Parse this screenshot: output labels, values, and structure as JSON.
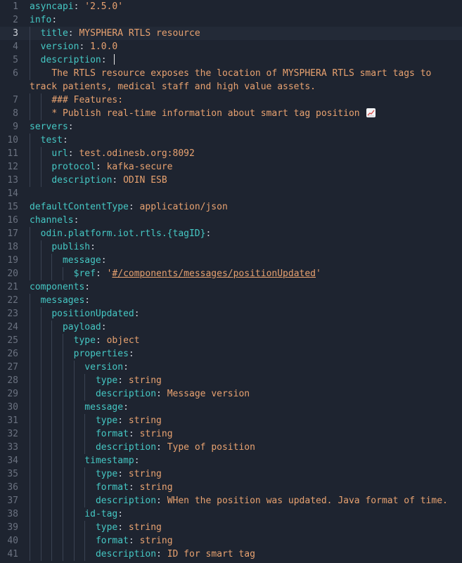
{
  "editor": {
    "current_line": 3,
    "lines": [
      {
        "n": "1",
        "indent": 0,
        "parts": [
          [
            "k",
            "asyncapi"
          ],
          [
            "p",
            ": "
          ],
          [
            "v",
            "'2.5.0'"
          ]
        ]
      },
      {
        "n": "2",
        "indent": 0,
        "parts": [
          [
            "k",
            "info"
          ],
          [
            "p",
            ":"
          ]
        ]
      },
      {
        "n": "3",
        "indent": 1,
        "parts": [
          [
            "k",
            "title"
          ],
          [
            "p",
            ": "
          ],
          [
            "v",
            "MYSPHERA RTLS resource"
          ]
        ]
      },
      {
        "n": "4",
        "indent": 1,
        "parts": [
          [
            "k",
            "version"
          ],
          [
            "p",
            ": "
          ],
          [
            "v",
            "1.0.0"
          ]
        ]
      },
      {
        "n": "5",
        "indent": 1,
        "parts": [
          [
            "k",
            "description"
          ],
          [
            "p",
            ": "
          ],
          [
            "v",
            "|"
          ]
        ]
      },
      {
        "n": "6",
        "indent": 1,
        "parts": [
          [
            "v",
            "  The RTLS resource exposes the location of MYSPHERA RTLS smart tags to track patients, medical staff and high value assets."
          ]
        ],
        "wrap": true
      },
      {
        "n": "7",
        "indent": 2,
        "parts": [
          [
            "v",
            "### Features:"
          ]
        ]
      },
      {
        "n": "8",
        "indent": 2,
        "parts": [
          [
            "v",
            "* Publish real-time information about smart tag position "
          ]
        ],
        "emoji": "chart-increasing-icon"
      },
      {
        "n": "9",
        "indent": 0,
        "parts": [
          [
            "k",
            "servers"
          ],
          [
            "p",
            ":"
          ]
        ]
      },
      {
        "n": "10",
        "indent": 1,
        "parts": [
          [
            "k",
            "test"
          ],
          [
            "p",
            ":"
          ]
        ]
      },
      {
        "n": "11",
        "indent": 2,
        "parts": [
          [
            "k",
            "url"
          ],
          [
            "p",
            ": "
          ],
          [
            "v",
            "test.odinesb.org:8092"
          ]
        ]
      },
      {
        "n": "12",
        "indent": 2,
        "parts": [
          [
            "k",
            "protocol"
          ],
          [
            "p",
            ": "
          ],
          [
            "v",
            "kafka-secure"
          ]
        ]
      },
      {
        "n": "13",
        "indent": 2,
        "parts": [
          [
            "k",
            "description"
          ],
          [
            "p",
            ": "
          ],
          [
            "v",
            "ODIN ESB"
          ]
        ]
      },
      {
        "n": "14",
        "indent": 0,
        "parts": []
      },
      {
        "n": "15",
        "indent": 0,
        "parts": [
          [
            "k",
            "defaultContentType"
          ],
          [
            "p",
            ": "
          ],
          [
            "v",
            "application/json"
          ]
        ]
      },
      {
        "n": "16",
        "indent": 0,
        "parts": [
          [
            "k",
            "channels"
          ],
          [
            "p",
            ":"
          ]
        ]
      },
      {
        "n": "17",
        "indent": 1,
        "parts": [
          [
            "k",
            "odin.platform.iot.rtls.{tagID}"
          ],
          [
            "p",
            ":"
          ]
        ]
      },
      {
        "n": "18",
        "indent": 2,
        "parts": [
          [
            "k",
            "publish"
          ],
          [
            "p",
            ":"
          ]
        ]
      },
      {
        "n": "19",
        "indent": 3,
        "parts": [
          [
            "k",
            "message"
          ],
          [
            "p",
            ":"
          ]
        ]
      },
      {
        "n": "20",
        "indent": 4,
        "parts": [
          [
            "k",
            "$ref"
          ],
          [
            "p",
            ": "
          ],
          [
            "v",
            "'"
          ],
          [
            "u",
            "#/components/messages/positionUpdated"
          ],
          [
            "v",
            "'"
          ]
        ]
      },
      {
        "n": "21",
        "indent": 0,
        "parts": [
          [
            "k",
            "components"
          ],
          [
            "p",
            ":"
          ]
        ]
      },
      {
        "n": "22",
        "indent": 1,
        "parts": [
          [
            "k",
            "messages"
          ],
          [
            "p",
            ":"
          ]
        ]
      },
      {
        "n": "23",
        "indent": 2,
        "parts": [
          [
            "k",
            "positionUpdated"
          ],
          [
            "p",
            ":"
          ]
        ]
      },
      {
        "n": "24",
        "indent": 3,
        "parts": [
          [
            "k",
            "payload"
          ],
          [
            "p",
            ":"
          ]
        ]
      },
      {
        "n": "25",
        "indent": 4,
        "parts": [
          [
            "k",
            "type"
          ],
          [
            "p",
            ": "
          ],
          [
            "v",
            "object"
          ]
        ]
      },
      {
        "n": "26",
        "indent": 4,
        "parts": [
          [
            "k",
            "properties"
          ],
          [
            "p",
            ":"
          ]
        ]
      },
      {
        "n": "27",
        "indent": 5,
        "parts": [
          [
            "k",
            "version"
          ],
          [
            "p",
            ":"
          ]
        ]
      },
      {
        "n": "28",
        "indent": 6,
        "parts": [
          [
            "k",
            "type"
          ],
          [
            "p",
            ": "
          ],
          [
            "v",
            "string"
          ]
        ]
      },
      {
        "n": "29",
        "indent": 6,
        "parts": [
          [
            "k",
            "description"
          ],
          [
            "p",
            ": "
          ],
          [
            "v",
            "Message version"
          ]
        ]
      },
      {
        "n": "30",
        "indent": 5,
        "parts": [
          [
            "k",
            "message"
          ],
          [
            "p",
            ":"
          ]
        ]
      },
      {
        "n": "31",
        "indent": 6,
        "parts": [
          [
            "k",
            "type"
          ],
          [
            "p",
            ": "
          ],
          [
            "v",
            "string"
          ]
        ]
      },
      {
        "n": "32",
        "indent": 6,
        "parts": [
          [
            "k",
            "format"
          ],
          [
            "p",
            ": "
          ],
          [
            "v",
            "string"
          ]
        ]
      },
      {
        "n": "33",
        "indent": 6,
        "parts": [
          [
            "k",
            "description"
          ],
          [
            "p",
            ": "
          ],
          [
            "v",
            "Type of position"
          ]
        ]
      },
      {
        "n": "34",
        "indent": 5,
        "parts": [
          [
            "k",
            "timestamp"
          ],
          [
            "p",
            ":"
          ]
        ]
      },
      {
        "n": "35",
        "indent": 6,
        "parts": [
          [
            "k",
            "type"
          ],
          [
            "p",
            ": "
          ],
          [
            "v",
            "string"
          ]
        ]
      },
      {
        "n": "36",
        "indent": 6,
        "parts": [
          [
            "k",
            "format"
          ],
          [
            "p",
            ": "
          ],
          [
            "v",
            "string"
          ]
        ]
      },
      {
        "n": "37",
        "indent": 6,
        "parts": [
          [
            "k",
            "description"
          ],
          [
            "p",
            ": "
          ],
          [
            "v",
            "WHen the position was updated. Java format of time."
          ]
        ]
      },
      {
        "n": "38",
        "indent": 5,
        "parts": [
          [
            "k",
            "id-tag"
          ],
          [
            "p",
            ":"
          ]
        ]
      },
      {
        "n": "39",
        "indent": 6,
        "parts": [
          [
            "k",
            "type"
          ],
          [
            "p",
            ": "
          ],
          [
            "v",
            "string"
          ]
        ]
      },
      {
        "n": "40",
        "indent": 6,
        "parts": [
          [
            "k",
            "format"
          ],
          [
            "p",
            ": "
          ],
          [
            "v",
            "string"
          ]
        ]
      },
      {
        "n": "41",
        "indent": 6,
        "parts": [
          [
            "k",
            "description"
          ],
          [
            "p",
            ": "
          ],
          [
            "v",
            "ID for smart tag"
          ]
        ]
      }
    ]
  },
  "colors": {
    "background": "#1e2430",
    "key": "#45c8c4",
    "value": "#e8a270",
    "gutter": "#6b7280"
  }
}
